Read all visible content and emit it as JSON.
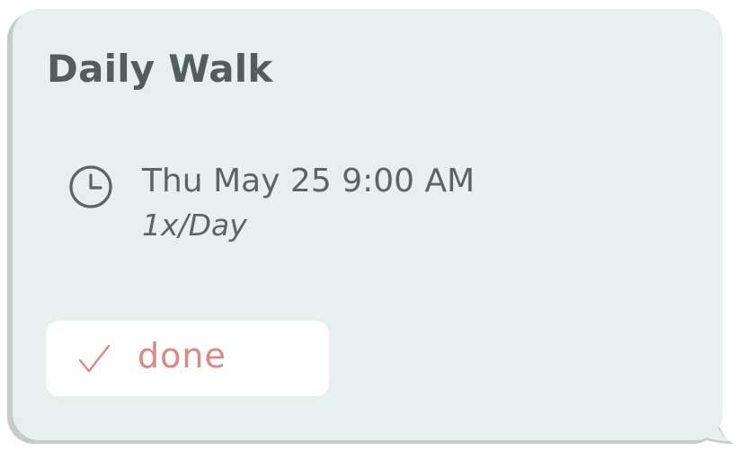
{
  "card": {
    "title": "Daily Walk",
    "schedule": {
      "icon": "clock-icon",
      "datetime": "Thu May 25 9:00 AM",
      "repeat": "1x/Day"
    },
    "done_button": {
      "icon": "check-icon",
      "label": "done"
    }
  },
  "colors": {
    "card_background": "#e8efef",
    "title_text": "#525d5e",
    "body_text": "#5a6566",
    "done_accent": "#d98a86",
    "button_background": "#ffffff"
  }
}
